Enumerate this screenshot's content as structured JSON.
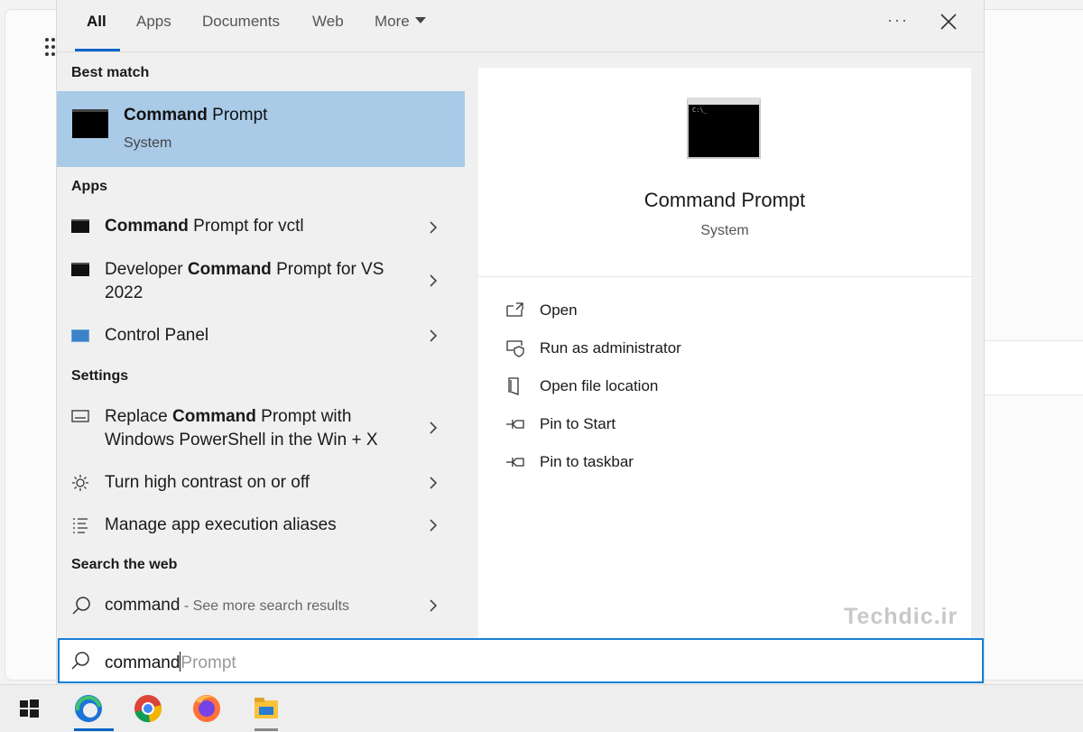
{
  "tabs": [
    {
      "label": "All",
      "active": true
    },
    {
      "label": "Apps"
    },
    {
      "label": "Documents"
    },
    {
      "label": "Web"
    },
    {
      "label": "More"
    }
  ],
  "best_match": {
    "section": "Best match",
    "title_bold": "Command",
    "title_rest": " Prompt",
    "subtitle": "System"
  },
  "apps": {
    "section": "Apps",
    "items": [
      {
        "pre": "",
        "bold": "Command",
        "post": " Prompt for vctl"
      },
      {
        "pre": "Developer ",
        "bold": "Command",
        "post": " Prompt for VS 2022"
      },
      {
        "pre": "Control Panel",
        "bold": "",
        "post": ""
      }
    ]
  },
  "settings": {
    "section": "Settings",
    "items": [
      {
        "pre": "Replace ",
        "bold": "Command",
        "post": " Prompt with Windows PowerShell in the Win + X"
      },
      {
        "pre": "Turn high contrast on or off",
        "bold": "",
        "post": ""
      },
      {
        "pre": "Manage app execution aliases",
        "bold": "",
        "post": ""
      }
    ]
  },
  "web": {
    "section": "Search the web",
    "query": "command",
    "more": " - See more search results"
  },
  "preview": {
    "title": "Command Prompt",
    "subtitle": "System",
    "actions": [
      {
        "label": "Open",
        "icon": "open-icon"
      },
      {
        "label": "Run as administrator",
        "icon": "shield-icon"
      },
      {
        "label": "Open file location",
        "icon": "file-location-icon"
      },
      {
        "label": "Pin to Start",
        "icon": "pin-icon"
      },
      {
        "label": "Pin to taskbar",
        "icon": "pin-icon"
      }
    ],
    "watermark": "Techdic.ir"
  },
  "search": {
    "typed": "command",
    "suggestion": "Prompt"
  },
  "taskbar": [
    "windows-start-icon",
    "edge-icon",
    "chrome-icon",
    "firefox-icon",
    "file-explorer-icon"
  ],
  "colors": {
    "accent": "#0a64c8",
    "selected": "#a9cbe8"
  }
}
